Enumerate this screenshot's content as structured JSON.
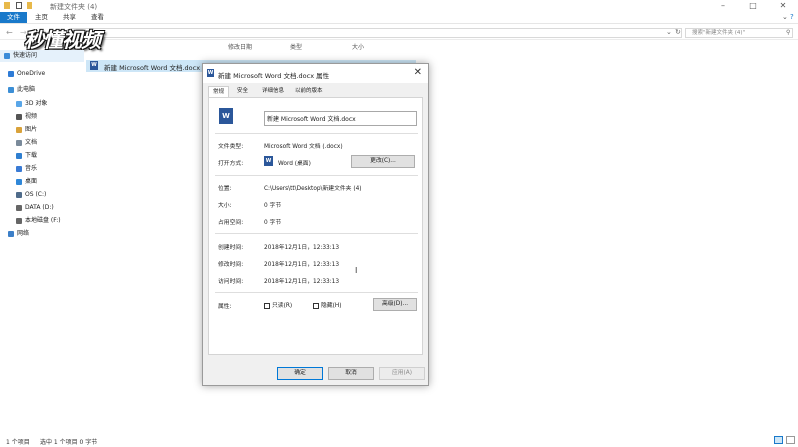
{
  "window": {
    "title": "新建文件夹 (4)"
  },
  "ribbon": {
    "tabs": [
      "文件",
      "主页",
      "共享",
      "查看"
    ]
  },
  "search": {
    "placeholder": "搜索\"新建文件夹 (4)\""
  },
  "watermark": "秒懂视频",
  "sidebar": {
    "items": [
      {
        "label": "快速访问",
        "icon": "star-icon",
        "color": "#3a8bd8"
      },
      {
        "label": "OneDrive",
        "icon": "cloud-icon",
        "color": "#2e7bd6"
      },
      {
        "label": "此电脑",
        "icon": "computer-icon",
        "color": "#3c8fd6"
      },
      {
        "label": "3D 对象",
        "icon": "cube-icon",
        "color": "#59a6e8"
      },
      {
        "label": "视频",
        "icon": "video-icon",
        "color": "#555555"
      },
      {
        "label": "图片",
        "icon": "picture-icon",
        "color": "#d9a23a"
      },
      {
        "label": "文档",
        "icon": "document-icon",
        "color": "#7a8a9a"
      },
      {
        "label": "下载",
        "icon": "download-icon",
        "color": "#2f7fd0"
      },
      {
        "label": "音乐",
        "icon": "music-icon",
        "color": "#3a7bd5"
      },
      {
        "label": "桌面",
        "icon": "desktop-icon",
        "color": "#2f87d8"
      },
      {
        "label": "OS (C:)",
        "icon": "drive-icon",
        "color": "#4f6b8a"
      },
      {
        "label": "DATA (D:)",
        "icon": "drive-icon",
        "color": "#666666"
      },
      {
        "label": "本地磁盘 (F:)",
        "icon": "drive-icon",
        "color": "#666666"
      },
      {
        "label": "网络",
        "icon": "network-icon",
        "color": "#3c7fc8"
      }
    ]
  },
  "filelist": {
    "columns": [
      "修改日期",
      "类型",
      "大小"
    ],
    "rows": [
      {
        "name": "新建 Microsoft Word 文档.docx"
      }
    ]
  },
  "statusbar": {
    "count": "1 个项目",
    "selected": "选中 1 个项目 0 字节"
  },
  "dialog": {
    "title": "新建 Microsoft Word 文档.docx 属性",
    "tabs": [
      "常规",
      "安全",
      "详细信息",
      "以前的版本"
    ],
    "filename": "新建 Microsoft Word 文档.docx",
    "filetype_label": "文件类型:",
    "filetype_value": "Microsoft Word 文档 (.docx)",
    "openwith_label": "打开方式:",
    "openwith_value": "Word (桌面)",
    "change_button": "更改(C)...",
    "location_label": "位置:",
    "location_value": "C:\\Users\\tt\\Desktop\\新建文件夹 (4)",
    "size_label": "大小:",
    "size_value": "0 字节",
    "disksize_label": "占用空间:",
    "disksize_value": "0 字节",
    "created_label": "创建时间:",
    "created_value": "2018年12月1日，12:33:13",
    "modified_label": "修改时间:",
    "modified_value": "2018年12月1日，12:33:13",
    "accessed_label": "访问时间:",
    "accessed_value": "2018年12月1日，12:33:13",
    "attrs_label": "属性:",
    "readonly_label": "只读(R)",
    "hidden_label": "隐藏(H)",
    "advanced_button": "高级(D)...",
    "ok_button": "确定",
    "cancel_button": "取消",
    "apply_button": "应用(A)"
  }
}
